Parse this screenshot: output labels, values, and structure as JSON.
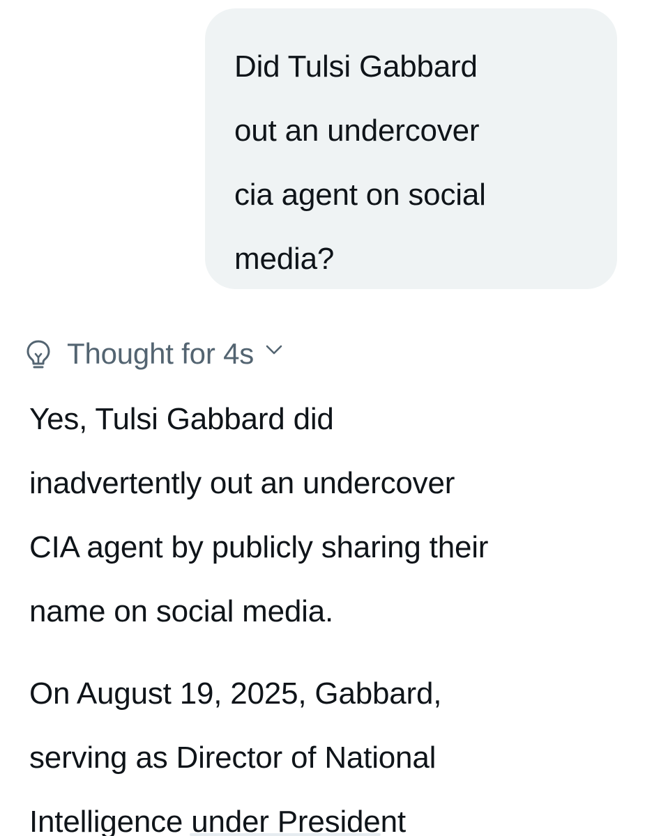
{
  "user_message": {
    "lines": [
      "Did Tulsi Gabbard",
      "out an undercover",
      "cia agent on social",
      "media?"
    ]
  },
  "thought": {
    "label": "Thought for 4s",
    "icon": "lightbulb-icon",
    "toggle_icon": "chevron-down-icon"
  },
  "answer": {
    "paragraph1_lines": [
      "Yes, Tulsi Gabbard did",
      "inadvertently out an undercover",
      "CIA agent by publicly sharing their",
      "name on social media."
    ],
    "paragraph2_lines": [
      "On August 19, 2025, Gabbard,",
      "serving as Director of National",
      "Intelligence under President"
    ]
  },
  "colors": {
    "bubble_bg": "#eff3f4",
    "text": "#0f1419",
    "muted": "#536471"
  }
}
